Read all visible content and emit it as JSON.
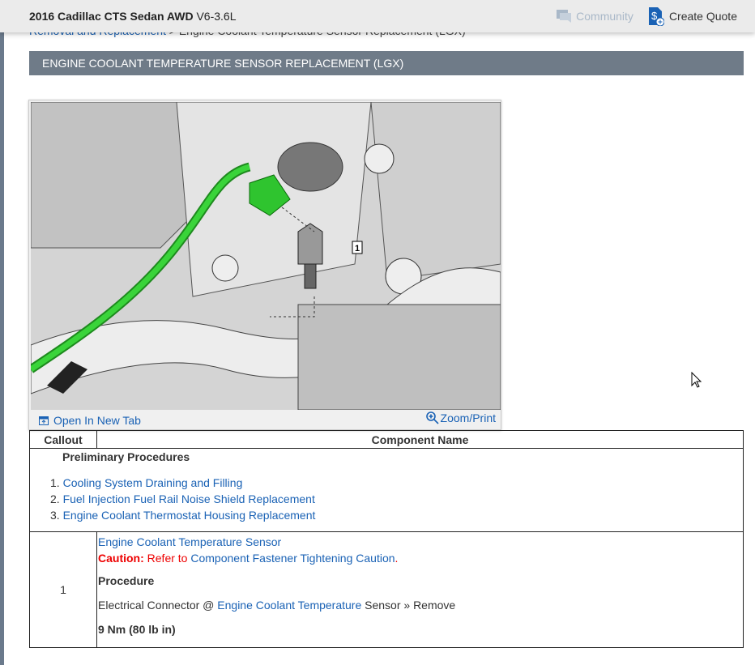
{
  "header": {
    "vehicle": "2016 Cadillac CTS Sedan AWD",
    "engine": "V6-3.6L",
    "community": "Community",
    "create_quote": "Create Quote"
  },
  "breadcrumb": {
    "parent": "Removal and Replacement",
    "separator": ">",
    "current": "Engine Coolant Temperature Sensor Replacement (LGX)"
  },
  "title": "ENGINE COOLANT TEMPERATURE SENSOR REPLACEMENT (LGX)",
  "figure": {
    "callout_label": "1",
    "open_tab": "Open In New Tab",
    "zoom_print": "Zoom/Print",
    "highlight_color": "#2fc42f"
  },
  "table": {
    "headers": [
      "Callout",
      "Component Name"
    ],
    "preliminary": {
      "title": "Preliminary Procedures",
      "items": [
        {
          "num": "1.",
          "label": "Cooling System Draining and Filling"
        },
        {
          "num": "2.",
          "label": "Fuel Injection Fuel Rail Noise Shield Replacement"
        },
        {
          "num": "3.",
          "label": "Engine Coolant Thermostat Housing Replacement"
        }
      ]
    },
    "rows": [
      {
        "callout": "1",
        "component": "Engine Coolant Temperature Sensor",
        "caution_label": "Caution:",
        "caution_text": " Refer to ",
        "caution_link": "Component Fastener Tightening Caution",
        "caution_end": ".",
        "procedure_title": "Procedure",
        "step_prefix": "Electrical Connector @ ",
        "step_link": "Engine Coolant Temperature",
        "step_suffix": " Sensor » Remove",
        "torque": "9 Nm (80 lb in)"
      }
    ]
  }
}
